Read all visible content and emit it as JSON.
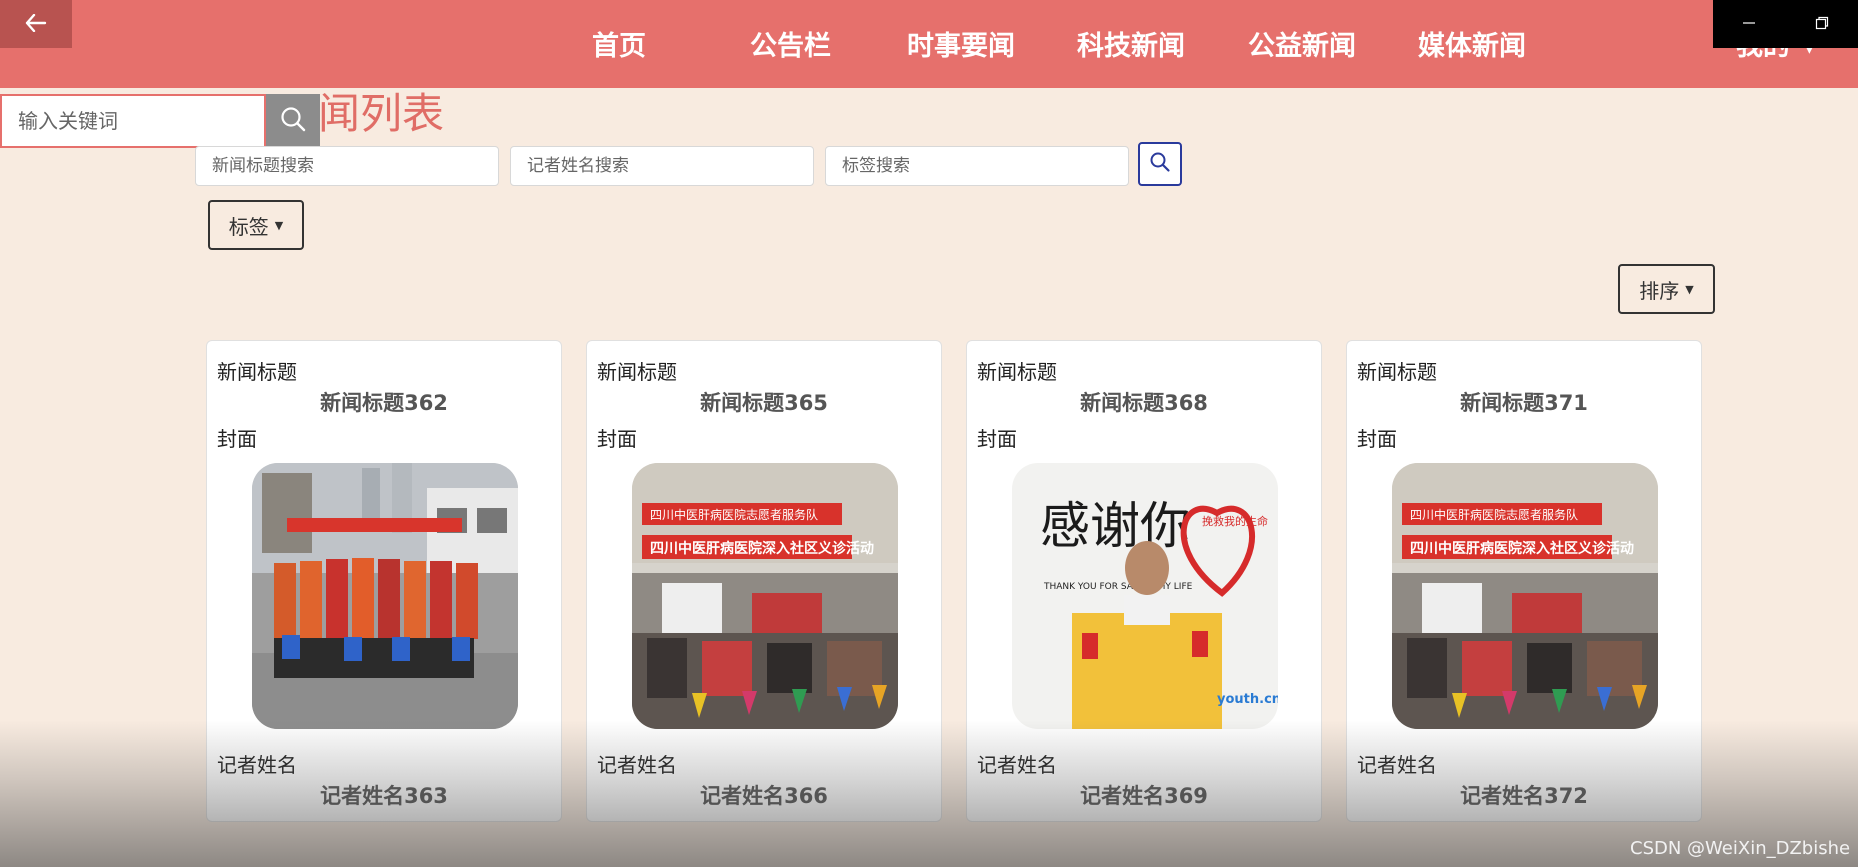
{
  "nav": {
    "items": [
      {
        "label": "首页"
      },
      {
        "label": "公告栏"
      },
      {
        "label": "时事要闻"
      },
      {
        "label": "科技新闻"
      },
      {
        "label": "公益新闻"
      },
      {
        "label": "媒体新闻"
      }
    ],
    "user_label": "我的"
  },
  "keyword_search": {
    "placeholder": "输入关键词"
  },
  "page": {
    "title": "闻列表"
  },
  "filters": {
    "title_placeholder": "新闻标题搜索",
    "reporter_placeholder": "记者姓名搜索",
    "tag_placeholder": "标签搜索"
  },
  "tag_dropdown": {
    "label": "标签"
  },
  "sort_dropdown": {
    "label": "排序"
  },
  "cards": [
    {
      "title_label": "新闻标题",
      "title": "新闻标题362",
      "cover_label": "封面",
      "reporter_label": "记者姓名",
      "reporter": "记者姓名363"
    },
    {
      "title_label": "新闻标题",
      "title": "新闻标题365",
      "cover_label": "封面",
      "reporter_label": "记者姓名",
      "reporter": "记者姓名366"
    },
    {
      "title_label": "新闻标题",
      "title": "新闻标题368",
      "cover_label": "封面",
      "reporter_label": "记者姓名",
      "reporter": "记者姓名369"
    },
    {
      "title_label": "新闻标题",
      "title": "新闻标题371",
      "cover_label": "封面",
      "reporter_label": "记者姓名",
      "reporter": "记者姓名372"
    }
  ],
  "cover_art": {
    "banner_1": "四川中医肝病医院志愿者服务队",
    "banner_2": "四川中医肝病医院深入社区义诊活动",
    "thanks_text": "感谢你",
    "thank_you_en": "THANK YOU FOR SAVING MY LIFE",
    "heart_text": "挽救我的生命",
    "site_mark": "youth.cn"
  },
  "watermark": "CSDN @WeiXin_DZbishe",
  "colors": {
    "topbar": "#e6706c",
    "background": "#f8ebe0",
    "title": "#e06d66"
  }
}
